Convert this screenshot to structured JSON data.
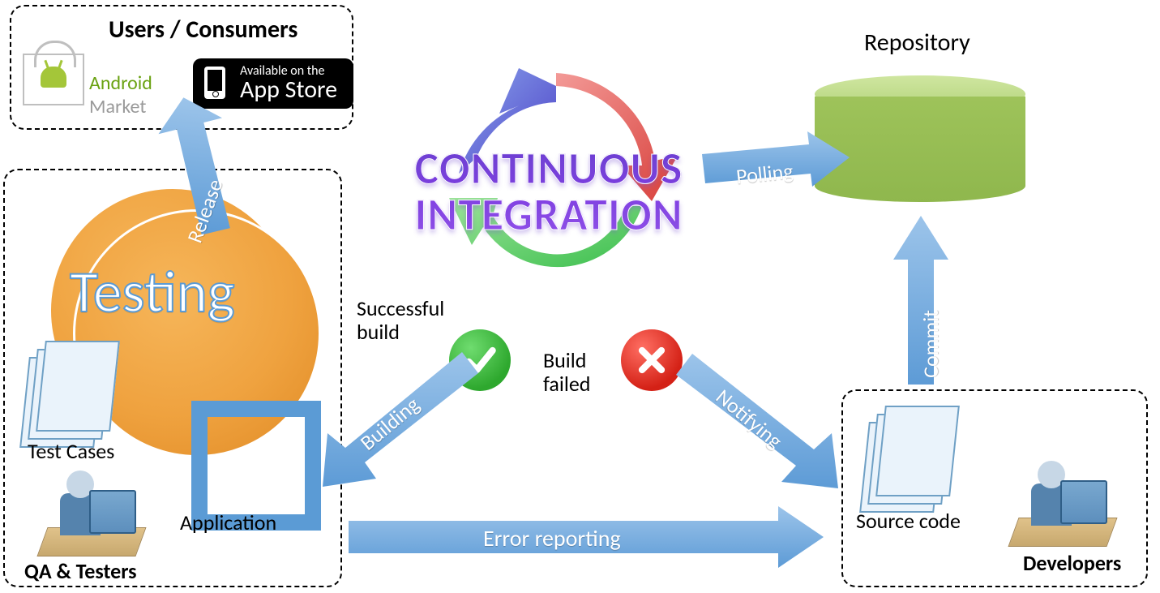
{
  "title": "CONTINUOUS INTEGRATION",
  "title_line1": "CONTINUOUS",
  "title_line2": "INTEGRATION",
  "boxes": {
    "consumers_title": "Users / Consumers",
    "qa_title": "QA & Testers",
    "dev_title": "Developers",
    "repo_title": "Repository"
  },
  "labels": {
    "testing": "Testing",
    "test_cases": "Test Cases",
    "application": "Application",
    "source_code": "Source code",
    "successful_build": "Successful build",
    "build_failed": "Build failed",
    "android_market_a": "Android",
    "android_market_b": "Market",
    "appstore_small": "Available on the",
    "appstore_big": "App Store"
  },
  "arrows": {
    "release": "Release",
    "building": "Building",
    "notifying": "Notifying",
    "error_reporting": "Error reporting",
    "polling": "Polling",
    "commit": "Commit"
  }
}
